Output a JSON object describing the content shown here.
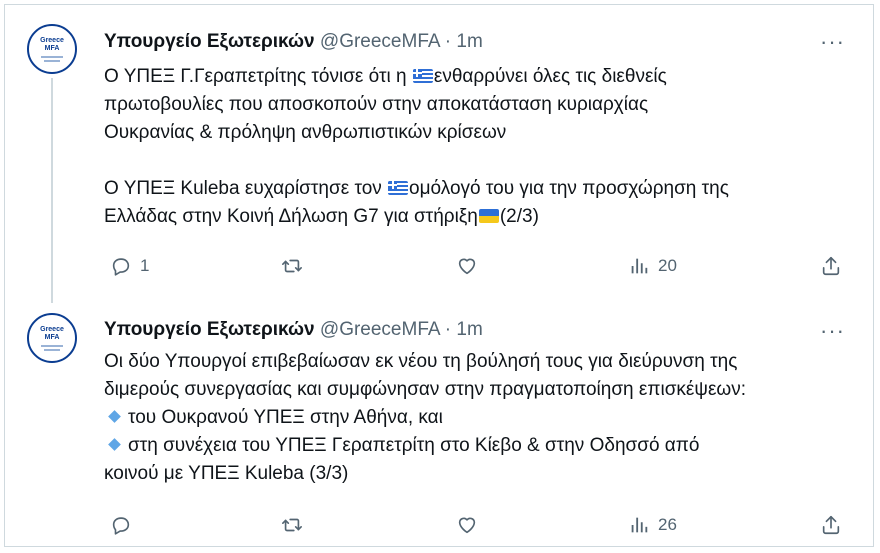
{
  "tweets": [
    {
      "author": {
        "name": "Υπουργείο Εξωτερικών",
        "handle": "@GreeceMFA",
        "separator": "·",
        "time": "1m",
        "avatar_text_top": "Greece",
        "avatar_text_bottom": "MFA"
      },
      "more_label": "···",
      "lines": {
        "l1_a": "Ο ΥΠΕΞ Γ.Γεραπετρίτης τόνισε ότι η ",
        "l1_flag": "greece-flag-icon",
        "l1_b": "ενθαρρύνει όλες τις διεθνείς",
        "l2": "πρωτοβουλίες που αποσκοπούν στην αποκατάσταση κυριαρχίας",
        "l3": "Ουκρανίας & πρόληψη ανθρωπιστικών κρίσεων",
        "l4_a": "Ο ΥΠΕΞ Kuleba ευχαρίστησε τον ",
        "l4_flag": "greece-flag-icon",
        "l4_b": "ομόλογό του για την προσχώρηση της",
        "l5_a": "Ελλάδας στην Κοινή Δήλωση G7 για στήριξη",
        "l5_flag": "ukraine-flag-icon",
        "l5_b": "(2/3)"
      },
      "stats": {
        "replies": "1",
        "retweets": "",
        "likes": "",
        "views": "20"
      }
    },
    {
      "author": {
        "name": "Υπουργείο Εξωτερικών",
        "handle": "@GreeceMFA",
        "separator": "·",
        "time": "1m",
        "avatar_text_top": "Greece",
        "avatar_text_bottom": "MFA"
      },
      "more_label": "···",
      "lines": {
        "l1": "Οι δύο Υπουργοί επιβεβαίωσαν εκ νέου τη βούλησή τους για διεύρυνση της",
        "l2": "διμερούς συνεργασίας και συμφώνησαν στην πραγματοποίηση επισκέψεων:",
        "l3_bullet": "small-blue-diamond-icon",
        "l3": "του Ουκρανού ΥΠΕΞ στην Αθήνα, και",
        "l4_bullet": "small-blue-diamond-icon",
        "l4": "στη συνέχεια του ΥΠΕΞ Γεραπετρίτη στο Κίεβο & στην Οδησσό από",
        "l5": "κοινού με ΥΠΕΞ Kuleba (3/3)"
      },
      "stats": {
        "replies": "",
        "retweets": "",
        "likes": "",
        "views": "26"
      }
    }
  ],
  "colors": {
    "text": "#0f1419",
    "muted": "#536471",
    "border": "#cfd9de",
    "avatar_ring": "#0b3d91"
  }
}
